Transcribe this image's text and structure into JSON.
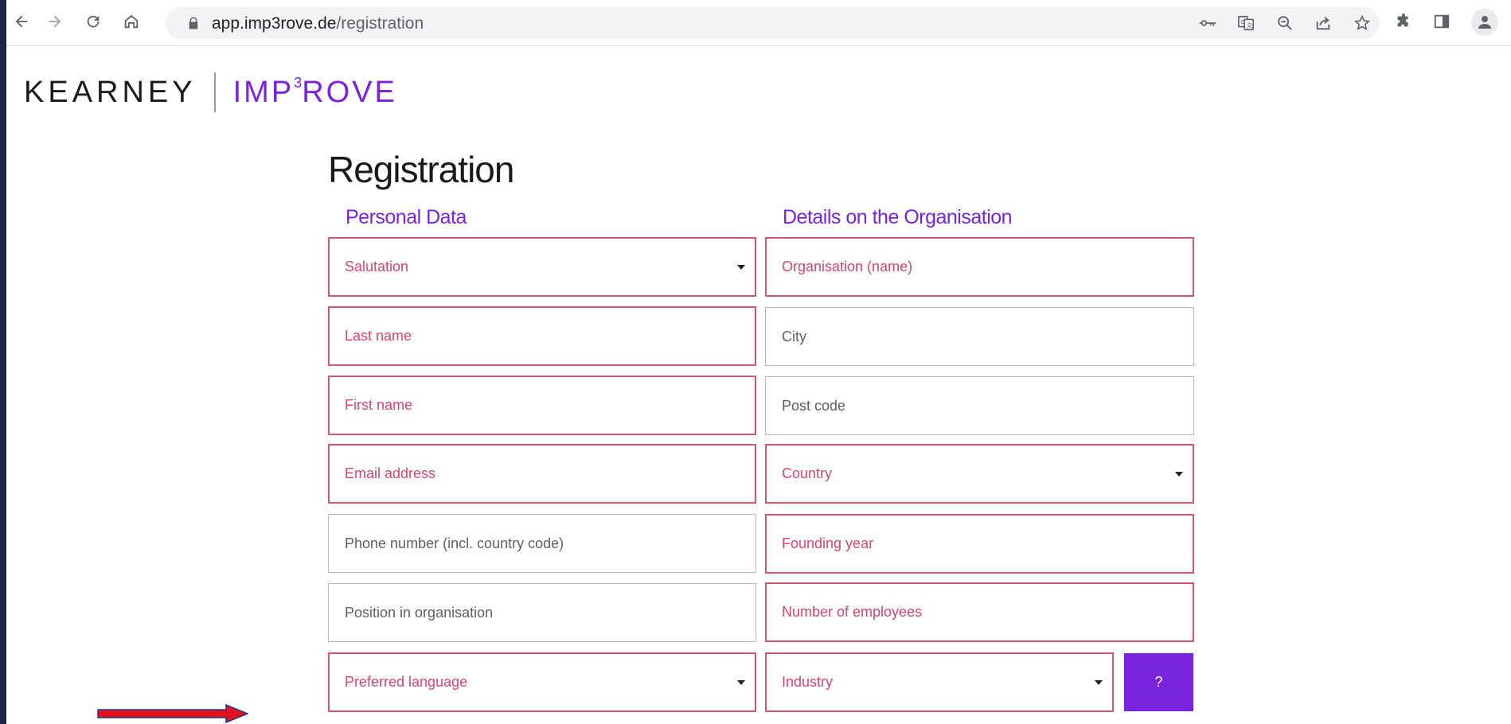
{
  "browser": {
    "url_host": "app.imp3rove.de",
    "url_path": "/registration"
  },
  "icons": [
    "back-arrow-icon",
    "forward-arrow-icon",
    "reload-icon",
    "home-icon",
    "lock-icon",
    "key-icon",
    "translate-icon",
    "zoom-out-icon",
    "share-icon",
    "star-icon",
    "puzzle-icon",
    "side-panel-icon",
    "profile-icon"
  ],
  "logo": {
    "brand": "KEARNEY",
    "product_prefix": "IMP",
    "product_sup": "3",
    "product_suffix": "ROVE"
  },
  "page": {
    "title": "Registration",
    "personal_heading": "Personal Data",
    "org_heading": "Details on the Organisation"
  },
  "personal_fields": [
    {
      "label": "Salutation",
      "required": true,
      "dropdown": true
    },
    {
      "label": "Last name",
      "required": true,
      "dropdown": false
    },
    {
      "label": "First name",
      "required": true,
      "dropdown": false
    },
    {
      "label": "Email address",
      "required": true,
      "dropdown": false
    },
    {
      "label": "Phone number (incl. country code)",
      "required": false,
      "dropdown": false
    },
    {
      "label": "Position in organisation",
      "required": false,
      "dropdown": false
    },
    {
      "label": "Preferred language",
      "required": true,
      "dropdown": true
    }
  ],
  "org_fields": [
    {
      "label": "Organisation (name)",
      "required": true,
      "dropdown": false
    },
    {
      "label": "City",
      "required": false,
      "dropdown": false
    },
    {
      "label": "Post code",
      "required": false,
      "dropdown": false
    },
    {
      "label": "Country",
      "required": true,
      "dropdown": true
    },
    {
      "label": "Founding year",
      "required": true,
      "dropdown": false
    },
    {
      "label": "Number of employees",
      "required": true,
      "dropdown": false
    },
    {
      "label": "Industry",
      "required": true,
      "dropdown": true
    }
  ],
  "help_button": "?",
  "colors": {
    "accent": "#7823dc",
    "required_border": "#d5566f",
    "required_text": "#d5456c",
    "annotation_arrow": "#e0121b"
  }
}
